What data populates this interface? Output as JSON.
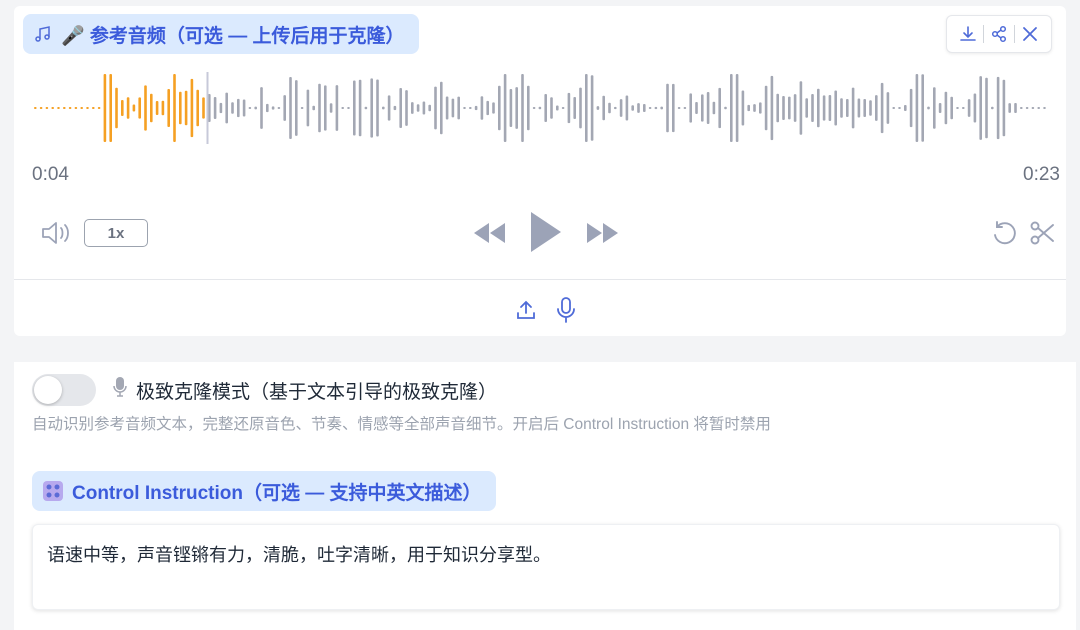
{
  "audio_panel": {
    "title": "🎤 参考音频（可选 — 上传后用于克隆）",
    "time_current": "0:04",
    "time_total": "0:23",
    "speed": "1x",
    "progress": 0.173,
    "played_color": "#f5a023",
    "unplayed_color": "#a3a7b3",
    "cursor_color": "#c7c9d9"
  },
  "clone_mode": {
    "enabled": false,
    "title": "极致克隆模式（基于文本引导的极致克隆）",
    "description": "自动识别参考音频文本，完整还原音色、节奏、情感等全部声音细节。开启后 Control Instruction 将暂时禁用"
  },
  "control_instruction": {
    "label": "Control Instruction（可选 — 支持中英文描述）",
    "value": "语速中等，声音铿锵有力，清脆，吐字清晰，用于知识分享型。"
  },
  "colors": {
    "accent": "#3b5bdb",
    "pill_bg": "#dbeafe",
    "control_gray": "#9ca3b7"
  }
}
